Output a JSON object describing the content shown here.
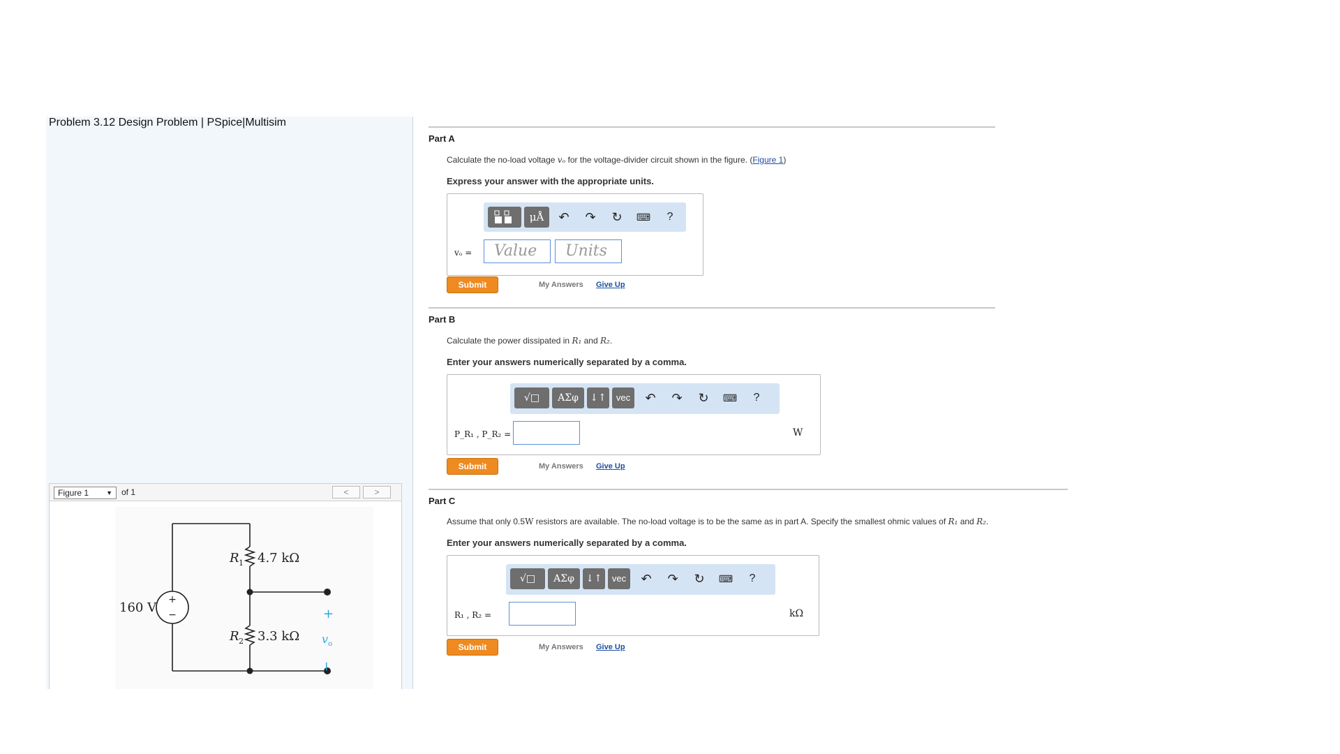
{
  "problem_title": "Problem 3.12 Design Problem | PSpice|Multisim",
  "figure_nav": {
    "select_value": "Figure 1",
    "of_text": "of 1",
    "prev": "<",
    "next": ">"
  },
  "circuit": {
    "source": "160 V",
    "r1_label": "R",
    "r1_sub": "1",
    "r1_value": "4.7 kΩ",
    "r2_label": "R",
    "r2_sub": "2",
    "r2_value": "3.3 kΩ",
    "plus": "+",
    "minus": "−",
    "vo_label": "v",
    "vo_sub": "o",
    "src_plus": "+",
    "src_minus": "−"
  },
  "part_a": {
    "title": "Part A",
    "prompt_start": "Calculate the no-load voltage ",
    "prompt_var": "vₒ",
    "prompt_end": " for the voltage-divider circuit shown in the figure. (",
    "prompt_link": "Figure 1",
    "prompt_close": ")",
    "instruction": "Express your answer with the appropriate units.",
    "toolbar_btn2": "μÅ",
    "toolbar_help": "?",
    "field_label": "vₒ =",
    "value_placeholder": "Value",
    "units_placeholder": "Units",
    "submit": "Submit",
    "my_answers": "My Answers",
    "give_up": "Give Up"
  },
  "part_b": {
    "title": "Part B",
    "prompt_start": "Calculate the power dissipated in ",
    "r1": "R₁",
    "and": " and ",
    "r2": "R₂",
    "period": ".",
    "instruction": "Enter your answers numerically separated by a comma.",
    "tb_sqrt": "√□",
    "tb_greek": "ΑΣφ",
    "tb_updown": "↓↑",
    "tb_vec": "vec",
    "toolbar_help": "?",
    "field_label": "P_R₁ , P_R₂ =",
    "unit": "W",
    "submit": "Submit",
    "my_answers": "My Answers",
    "give_up": "Give Up"
  },
  "part_c": {
    "title": "Part C",
    "prompt_start": "Assume that only 0.5",
    "watt": "W",
    "prompt_mid": " resistors are available. The no-load voltage is to be the same as in part A. Specify the smallest ohmic values of ",
    "r1": "R₁",
    "and": " and ",
    "r2": "R₂",
    "period": ".",
    "instruction": "Enter your answers numerically separated by a comma.",
    "tb_sqrt": "√□",
    "tb_greek": "ΑΣφ",
    "tb_updown": "↓↑",
    "tb_vec": "vec",
    "toolbar_help": "?",
    "field_label": "R₁ , R₂ =",
    "unit": "kΩ",
    "submit": "Submit",
    "my_answers": "My Answers",
    "give_up": "Give Up"
  },
  "colors": {
    "submit": "#ee8a1f",
    "link": "#1d4fa0",
    "toolbar_bg": "#d5e4f4",
    "panel_bg": "#f2f7fc"
  }
}
